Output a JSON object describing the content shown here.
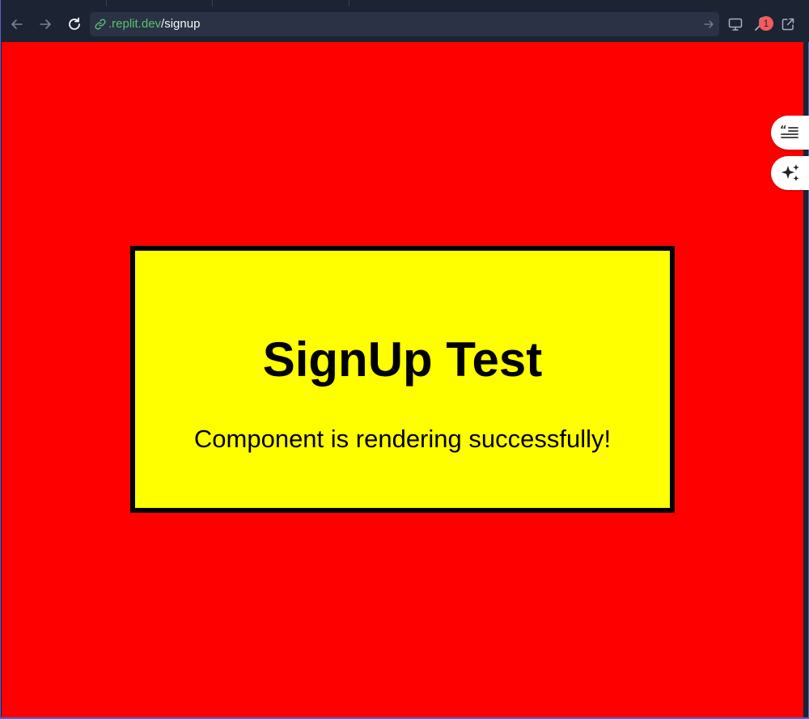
{
  "browser": {
    "url": {
      "host": ".replit.dev",
      "path": "/signup"
    },
    "notification_count": "1",
    "icons": {
      "back": "arrow-left-icon",
      "forward": "arrow-right-icon",
      "reload": "reload-icon",
      "link": "link-icon",
      "go": "arrow-right-icon",
      "devices": "monitor-icon",
      "devtools": "wrench-icon",
      "open_new": "external-link-icon"
    }
  },
  "page": {
    "background_color": "#ff0000",
    "card_color": "#ffff00",
    "title": "SignUp Test",
    "message": "Component is rendering successfully!"
  },
  "floating_buttons": [
    {
      "icon": "quote-list-icon"
    },
    {
      "icon": "sparkles-icon"
    }
  ]
}
